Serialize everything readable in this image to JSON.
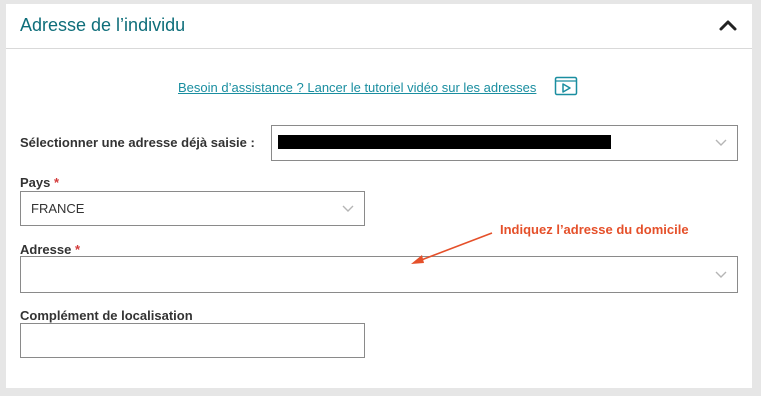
{
  "section": {
    "title": "Adresse de l’individu"
  },
  "help": {
    "link_text": "Besoin d’assistance ? Lancer le tutoriel vidéo sur les adresses"
  },
  "saved_address": {
    "label": "Sélectionner une adresse déjà saisie :"
  },
  "country": {
    "label": "Pays",
    "required_mark": "*",
    "value": "FRANCE"
  },
  "address": {
    "label": "Adresse",
    "required_mark": "*",
    "value": ""
  },
  "complement": {
    "label": "Complément de localisation",
    "value": ""
  },
  "annotation": {
    "text": "Indiquez l’adresse du domicile",
    "color": "#e5502a"
  },
  "colors": {
    "title": "#0e6e7a",
    "link": "#1a8ea0",
    "required": "#d33a3a"
  }
}
